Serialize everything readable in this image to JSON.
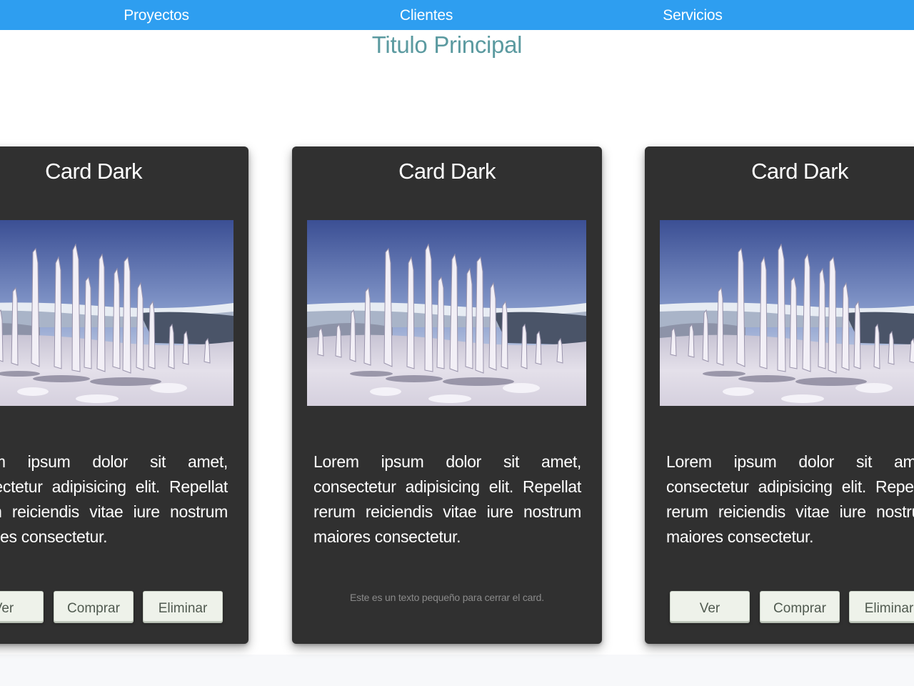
{
  "nav": {
    "items": [
      {
        "label": "Proyectos"
      },
      {
        "label": "Clientes"
      },
      {
        "label": "Servicios"
      }
    ]
  },
  "page_title": "Titulo Principal",
  "cards": [
    {
      "title": "Card Dark",
      "image": "frozen-trees-snow-landscape",
      "text": "Lorem ipsum dolor sit amet, consectetur adipisicing elit. Repellat rerum reiciendis vitae iure nostrum maiores consectetur.",
      "buttons": {
        "view": "Ver",
        "buy": "Comprar",
        "delete": "Eliminar"
      }
    },
    {
      "title": "Card Dark",
      "image": "frozen-trees-snow-landscape",
      "text": "Lorem ipsum dolor sit amet, consectetur adipisicing elit. Repellat rerum reiciendis vitae iure nostrum maiores consectetur.",
      "footer_text": "Este es un texto pequeño para cerrar el card."
    },
    {
      "title": "Card Dark",
      "image": "frozen-trees-snow-landscape",
      "text": "Lorem ipsum dolor sit amet, consectetur adipisicing elit. Repellat rerum reiciendis vitae iure nostrum maiores consectetur.",
      "buttons": {
        "view": "Ver",
        "buy": "Comprar",
        "delete": "Eliminar"
      }
    }
  ],
  "colors": {
    "navbar": "#2e9ef0",
    "title": "#5b9aa0",
    "card_bg": "#303030",
    "button_bg": "#eef2ea"
  }
}
